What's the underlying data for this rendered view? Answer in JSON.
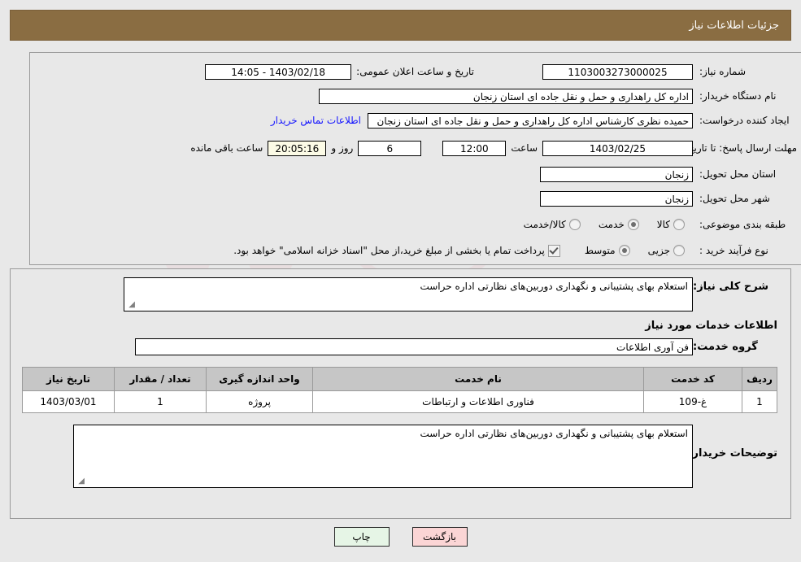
{
  "header": {
    "title": "جزئیات اطلاعات نیاز",
    "bg_color": "#8a6d42",
    "text_color": "#ffffff"
  },
  "details": {
    "need_number_label": "شماره نیاز:",
    "need_number_value": "1103003273000025",
    "announce_label": "تاریخ و ساعت اعلان عمومی:",
    "announce_value": "1403/02/18 - 14:05",
    "buyer_org_label": "نام دستگاه خریدار:",
    "buyer_org_value": "اداره کل راهداری و حمل و نقل جاده ای استان زنجان",
    "creator_label": "ایجاد کننده درخواست:",
    "creator_value": "حمیده نظری کارشناس اداره کل راهداری و حمل و نقل جاده ای استان زنجان",
    "contact_link": "اطلاعات تماس خریدار",
    "deadline_label": "مهلت ارسال پاسخ: تا تاریخ:",
    "deadline_date": "1403/02/25",
    "deadline_time_label": "ساعت",
    "deadline_time": "12:00",
    "remaining_days": "6",
    "remaining_days_label": "روز و",
    "remaining_clock": "20:05:16",
    "remaining_clock_label": "ساعت باقی مانده",
    "province_label": "استان محل تحویل:",
    "province_value": "زنجان",
    "city_label": "شهر محل تحویل:",
    "city_value": "زنجان",
    "category_label": "طبقه بندی موضوعی:",
    "category_options": [
      {
        "label": "کالا",
        "selected": false
      },
      {
        "label": "خدمت",
        "selected": true
      },
      {
        "label": "کالا/خدمت",
        "selected": false
      }
    ],
    "purchase_label": "نوع فرآیند خرید :",
    "purchase_options": [
      {
        "label": "جزیی",
        "selected": false
      },
      {
        "label": "متوسط",
        "selected": true
      }
    ],
    "treasury_checkbox_checked": true,
    "treasury_note": "پرداخت تمام یا بخشی از مبلغ خرید،از محل \"اسناد خزانه اسلامی\" خواهد بود."
  },
  "summary": {
    "label": "شرح کلی نیاز:",
    "value": "استعلام بهای پشتیبانی و نگهداری دوربین‌های نظارتی اداره حراست"
  },
  "services": {
    "section_title": "اطلاعات خدمات مورد نیاز",
    "group_label": "گروه خدمت:",
    "group_value": "فن آوری اطلاعات",
    "columns": [
      "ردیف",
      "کد خدمت",
      "نام خدمت",
      "واحد اندازه گیری",
      "تعداد / مقدار",
      "تاریخ نیاز"
    ],
    "rows": [
      {
        "index": "1",
        "code": "غ-109",
        "name": "فناوری اطلاعات و ارتباطات",
        "unit": "پروژه",
        "quantity": "1",
        "need_date": "1403/03/01"
      }
    ]
  },
  "buyer_notes": {
    "label": "توضیحات خریدار:",
    "value": "استعلام بهای پشتیبانی و نگهداری دوربین‌های نظارتی اداره حراست"
  },
  "buttons": {
    "print": "چاپ",
    "back": "بازگشت"
  },
  "watermark": {
    "text": "AriaTender.net"
  }
}
